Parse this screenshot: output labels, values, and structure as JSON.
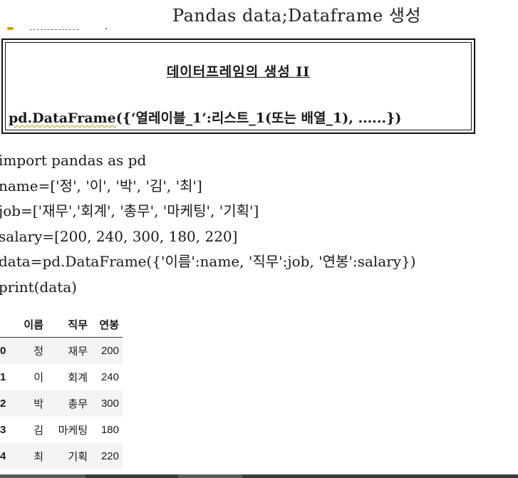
{
  "page": {
    "title": "Pandas  data;Dataframe 생성"
  },
  "definition_box": {
    "heading": "데이터프레임의 생성 II",
    "syntax_prefix": "pd.DataFrame",
    "syntax_rest": "({‘열레이블_1’:리스트_1(또는 배열_1), ......})"
  },
  "code": {
    "lines": [
      "import pandas as pd",
      "name=['정', '이', '박', '김', '최']",
      "job=['재무','회계', '총무', '마케팅', '기획']",
      "salary=[200, 240, 300, 180, 220]",
      "data=pd.DataFrame({'이름':name, '직무':job, '연봉':salary})",
      "print(data)"
    ]
  },
  "dataframe": {
    "columns": [
      "이름",
      "직무",
      "연봉"
    ],
    "rows": [
      {
        "index": "0",
        "name": "정",
        "job": "재무",
        "salary": "200"
      },
      {
        "index": "1",
        "name": "이",
        "job": "회계",
        "salary": "240"
      },
      {
        "index": "2",
        "name": "박",
        "job": "총무",
        "salary": "300"
      },
      {
        "index": "3",
        "name": "김",
        "job": "마케팅",
        "salary": "180"
      },
      {
        "index": "4",
        "name": "최",
        "job": "기획",
        "salary": "220"
      }
    ]
  },
  "colors": {
    "spellcheck_underline": "#c9a400",
    "row_stripe": "#f4f4f4",
    "taskbar": "#3a3a3a"
  }
}
